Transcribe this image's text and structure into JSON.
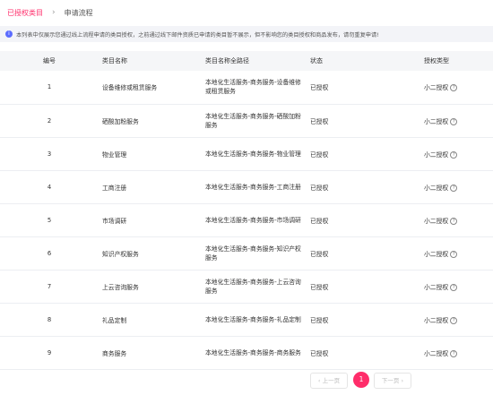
{
  "tabs": {
    "active": "已授权类目",
    "separator": "›",
    "other": "申请流程"
  },
  "notice": "本列表中仅展示您通过线上流程申请的类目授权，之前通过线下邮件资质已申请的类目暂不展示，但不影响您的类目授权和商品发布，请勿重复申请!",
  "table": {
    "headers": {
      "id": "编号",
      "name": "类目名称",
      "path": "类目名称全路径",
      "status": "状态",
      "type": "授权类型"
    },
    "rows": [
      {
        "id": "1",
        "name": "设备维修或租赁服务",
        "path": "本地化生活服务-商务服务-设备维修或租赁服务",
        "status": "已授权",
        "type": "小二授权"
      },
      {
        "id": "2",
        "name": "硒酸加粉服务",
        "path": "本地化生活服务-商务服务-硒酸加粉服务",
        "status": "已授权",
        "type": "小二授权"
      },
      {
        "id": "3",
        "name": "物业管理",
        "path": "本地化生活服务-商务服务-物业管理",
        "status": "已授权",
        "type": "小二授权"
      },
      {
        "id": "4",
        "name": "工商注册",
        "path": "本地化生活服务-商务服务-工商注册",
        "status": "已授权",
        "type": "小二授权"
      },
      {
        "id": "5",
        "name": "市场调研",
        "path": "本地化生活服务-商务服务-市场调研",
        "status": "已授权",
        "type": "小二授权"
      },
      {
        "id": "6",
        "name": "知识产权服务",
        "path": "本地化生活服务-商务服务-知识产权服务",
        "status": "已授权",
        "type": "小二授权"
      },
      {
        "id": "7",
        "name": "上云咨询服务",
        "path": "本地化生活服务-商务服务-上云咨询服务",
        "status": "已授权",
        "type": "小二授权"
      },
      {
        "id": "8",
        "name": "礼品定制",
        "path": "本地化生活服务-商务服务-礼品定制",
        "status": "已授权",
        "type": "小二授权"
      },
      {
        "id": "9",
        "name": "商务服务",
        "path": "本地化生活服务-商务服务-商务服务",
        "status": "已授权",
        "type": "小二授权"
      }
    ]
  },
  "pagination": {
    "prev": "‹ 上一页",
    "current": "1",
    "next": "下一页 ›"
  },
  "colors": {
    "accent": "#ff2d6a",
    "info": "#5b6cff"
  }
}
